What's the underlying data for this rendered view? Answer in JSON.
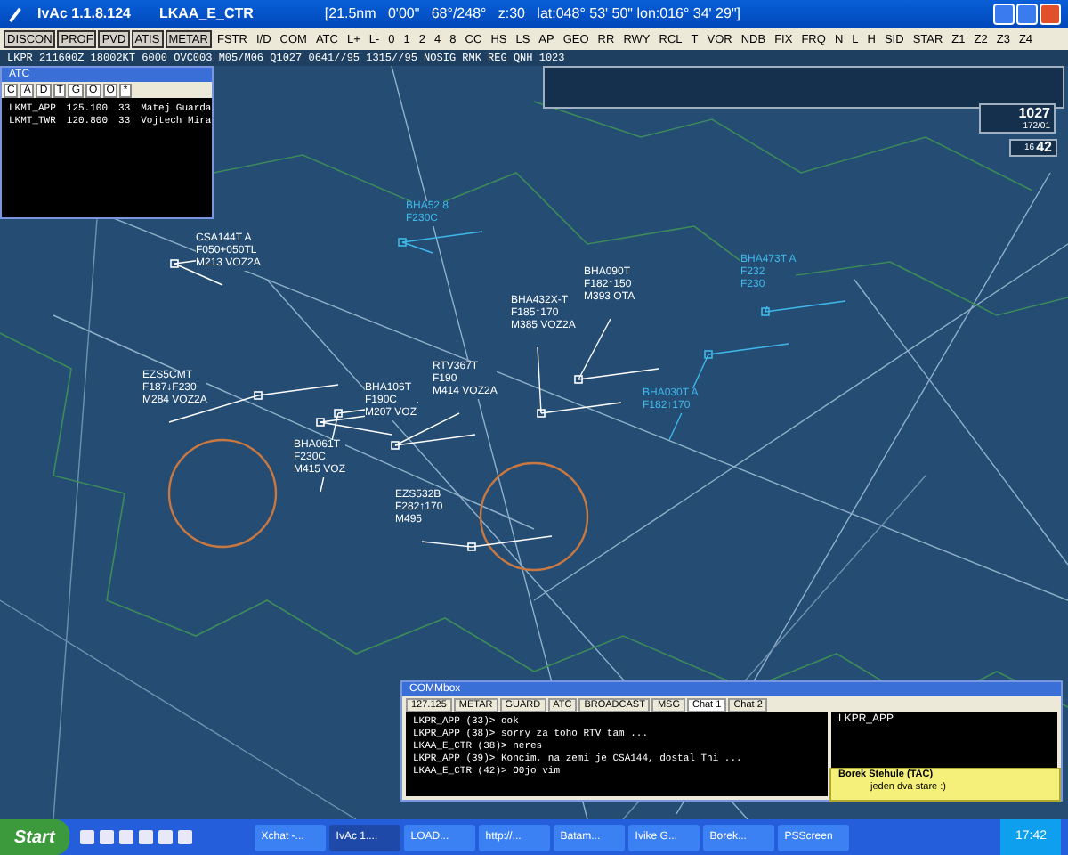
{
  "window": {
    "title": "IvAc 1.1.8.124",
    "position": "LKAA_E_CTR",
    "cursor_info": "[21.5nm   0'00\"   68°/248°   z:30   lat:048° 53' 50\" lon:016° 34' 29\"]"
  },
  "toolbar": [
    {
      "label": "DISCON",
      "pressed": true
    },
    {
      "label": "PROF",
      "pressed": true
    },
    {
      "label": "PVD",
      "pressed": true
    },
    {
      "label": "ATIS",
      "pressed": true
    },
    {
      "label": "METAR",
      "pressed": true
    },
    {
      "label": "FSTR",
      "pressed": false
    },
    {
      "label": "I/D",
      "pressed": false
    },
    {
      "label": "COM",
      "pressed": false
    },
    {
      "label": "ATC",
      "pressed": false
    },
    {
      "label": "L+",
      "pressed": false
    },
    {
      "label": "L-",
      "pressed": false
    },
    {
      "label": "0",
      "pressed": false
    },
    {
      "label": "1",
      "pressed": false
    },
    {
      "label": "2",
      "pressed": false
    },
    {
      "label": "4",
      "pressed": false
    },
    {
      "label": "8",
      "pressed": false
    },
    {
      "label": "CC",
      "pressed": false
    },
    {
      "label": "HS",
      "pressed": false
    },
    {
      "label": "LS",
      "pressed": false
    },
    {
      "label": "AP",
      "pressed": false
    },
    {
      "label": "GEO",
      "pressed": false
    },
    {
      "label": "RR",
      "pressed": false
    },
    {
      "label": "RWY",
      "pressed": false
    },
    {
      "label": "RCL",
      "pressed": false
    },
    {
      "label": "T",
      "pressed": false
    },
    {
      "label": "VOR",
      "pressed": false
    },
    {
      "label": "NDB",
      "pressed": false
    },
    {
      "label": "FIX",
      "pressed": false
    },
    {
      "label": "FRQ",
      "pressed": false
    },
    {
      "label": "N",
      "pressed": false
    },
    {
      "label": "L",
      "pressed": false
    },
    {
      "label": "H",
      "pressed": false
    },
    {
      "label": "SID",
      "pressed": false
    },
    {
      "label": "STAR",
      "pressed": false
    },
    {
      "label": "Z1",
      "pressed": false
    },
    {
      "label": "Z2",
      "pressed": false
    },
    {
      "label": "Z3",
      "pressed": false
    },
    {
      "label": "Z4",
      "pressed": false
    }
  ],
  "metar": "LKPR 211600Z 18002KT 6000 OVC003 M05/M06 Q1027 0641//95 1315//95 NOSIG RMK REG QNH 1023",
  "atc_window": {
    "title": "ATC",
    "tabs": [
      "C",
      "A",
      "D",
      "T",
      "G",
      "O",
      "O",
      "*"
    ],
    "rows": [
      {
        "callsign": "LKMT_APP",
        "frequency": "125.100",
        "rating": "33",
        "name": "Matej Guarda"
      },
      {
        "callsign": "LKMT_TWR",
        "frequency": "120.800",
        "rating": "33",
        "name": "Vojtech Mira"
      }
    ]
  },
  "pressure": {
    "qnh": "1027",
    "wind": "172/01"
  },
  "clock": {
    "hours": "16",
    "minutes": "42"
  },
  "aircraft": [
    {
      "kind": "controlled",
      "lines": [
        "CSA144T A",
        "F050+050TL",
        "M213 VOZ2A"
      ]
    },
    {
      "kind": "controlled",
      "lines": [
        "EZS5CMT",
        "F187↓F230",
        "M284 VOZ2A"
      ]
    },
    {
      "kind": "controlled",
      "lines": [
        "BHA106T",
        "F190C",
        "M207 VOZ"
      ]
    },
    {
      "kind": "controlled",
      "lines": [
        "RTV367T",
        "F190",
        "M414 VOZ2A"
      ]
    },
    {
      "kind": "controlled",
      "lines": [
        "BHA432X-T",
        "F185↑170",
        "M385 VOZ2A"
      ]
    },
    {
      "kind": "controlled",
      "lines": [
        "BHA090T",
        "F182↑150",
        "M393 OTA"
      ]
    },
    {
      "kind": "controlled",
      "lines": [
        "BHA061T",
        "F230C",
        "M415 VOZ"
      ]
    },
    {
      "kind": "controlled",
      "lines": [
        "EZS532B",
        "F282↑170",
        "M495"
      ]
    },
    {
      "kind": "other",
      "lines": [
        "BHA030T A",
        "F182↑170"
      ]
    },
    {
      "kind": "other",
      "lines": [
        "BHA473T A",
        "F232",
        "F230"
      ]
    },
    {
      "kind": "other",
      "lines": [
        "BHA52 8",
        "F230C"
      ]
    }
  ],
  "commbox": {
    "title": "COMMbox",
    "tabs": [
      {
        "label": "127.125",
        "selected": false
      },
      {
        "label": "METAR",
        "selected": false
      },
      {
        "label": "GUARD",
        "selected": false
      },
      {
        "label": "ATC",
        "selected": false
      },
      {
        "label": "BROADCAST",
        "selected": false
      },
      {
        "label": "MSG",
        "selected": false
      },
      {
        "label": "Chat 1",
        "selected": true
      },
      {
        "label": "Chat 2",
        "selected": false
      }
    ],
    "messages": [
      "LKPR_APP (33)> ook",
      "LKPR_APP (38)> sorry za toho RTV tam ...",
      "LKAA_E_CTR (38)> neres",
      "LKPR_APP (39)> Koncim, na zemi je CSA144, dostal Tni ...",
      "LKAA_E_CTR (42)> O0jo vim"
    ],
    "participants": [
      "LKPR_APP"
    ]
  },
  "notification": {
    "title": "Borek Stehule (TAC)",
    "message": "jeden dva stare :)"
  },
  "taskbar": {
    "start": "Start",
    "tasks": [
      {
        "label": "Xchat -...",
        "selected": false
      },
      {
        "label": "IvAc 1....",
        "selected": true
      },
      {
        "label": "LOAD...",
        "selected": false
      },
      {
        "label": "http://...",
        "selected": false
      },
      {
        "label": "Batam...",
        "selected": false
      },
      {
        "label": "Ivike G...",
        "selected": false
      },
      {
        "label": "Borek...",
        "selected": false
      },
      {
        "label": "PSScreen",
        "selected": false
      }
    ],
    "clock": "17:42"
  }
}
